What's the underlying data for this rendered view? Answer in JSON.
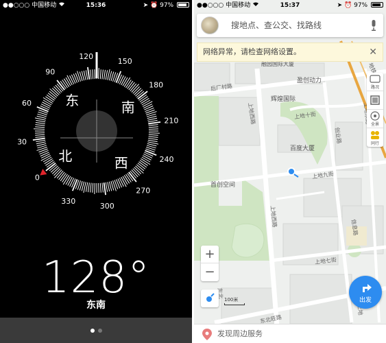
{
  "compass_screen": {
    "status": {
      "signal": "●●○○○",
      "carrier": "中国移动",
      "wifi": "wifi",
      "time": "15:36",
      "battery": "97%"
    },
    "heading_degrees": 128,
    "degree_text": "128°",
    "direction_text": "东南",
    "cardinal_labels": {
      "east": "东",
      "south": "南",
      "north": "北",
      "west": "西"
    },
    "degree_labels": [
      "0",
      "30",
      "60",
      "90",
      "120",
      "150",
      "180",
      "210",
      "240",
      "270",
      "300",
      "330"
    ],
    "page_dots": {
      "count": 2,
      "active": 0
    },
    "colors": {
      "background": "#000000",
      "foreground": "#ffffff",
      "north_marker": "#e0242b"
    }
  },
  "map_screen": {
    "status": {
      "signal": "●●○○○",
      "carrier": "中国移动",
      "wifi": "wifi",
      "time": "15:37",
      "battery": "97%"
    },
    "search": {
      "placeholder": "搜地点、查公交、找路线"
    },
    "warning": {
      "text": "网络异常，请检查网络设置。",
      "close": "✕"
    },
    "side_tools": [
      {
        "icon": "traffic-icon",
        "label": "路况"
      },
      {
        "icon": "layers-icon",
        "label": ""
      },
      {
        "icon": "street-view-icon",
        "label": "全景"
      },
      {
        "icon": "group-icon",
        "label": "同行"
      }
    ],
    "zoom": {
      "in": "+",
      "out": "−"
    },
    "scale": "100米",
    "go_button": "出发",
    "bottom": {
      "text": "发现周边服务"
    },
    "places": {
      "poi_1": "辉煌国际",
      "poi_2": "盈创动力",
      "poi_3": "百度大厦",
      "poi_4": "首创空间",
      "partial_top": "融园国际大厦"
    },
    "roads": {
      "r1": "后厂村路",
      "r2": "上地十街",
      "r3": "上地西路",
      "r4": "创业路",
      "r5": "上地九街",
      "r6": "上地七街",
      "r7": "信息路",
      "r8": "东北旺路",
      "r9": "上地西路",
      "r10": "地铁",
      "r11": "东北",
      "r12": "上地",
      "r13": "上地东路"
    },
    "colors": {
      "accent": "#2d8cf0",
      "park": "#cfe5c2",
      "road": "#ffffff",
      "block": "#e4e6e4",
      "metro": "#e8a640"
    }
  }
}
